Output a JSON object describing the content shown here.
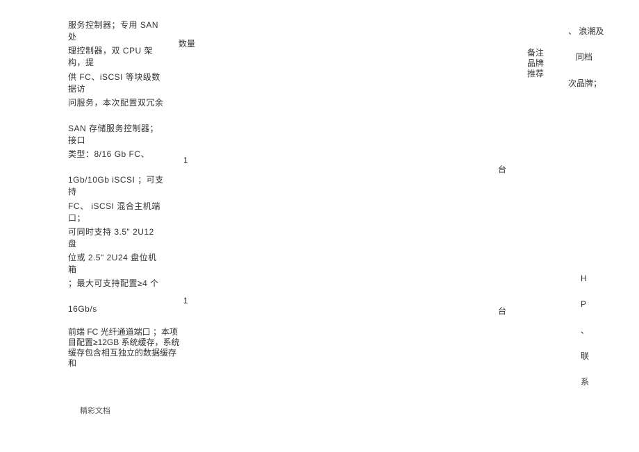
{
  "leftColumn": {
    "line1": "服务控制器；专用   SAN 处",
    "line2": "理控制器，双 CPU 架构，提",
    "line3": "供 FC、iSCSI 等块级数据访",
    "line4": "问服务，本次配置双冗余",
    "line5": "SAN 存储服务控制器；接口",
    "line6": "类型：8/16 Gb FC、",
    "line7": "1Gb/10Gb iSCSI ；可支持",
    "line8": "FC、 iSCSI 混合主机端  口；",
    "line9": "可同时支持 3.5\"   2U12 盘",
    "line10": "位或 2.5\"   2U24 盘位机箱",
    "line11": "；最大可支持配置≥4 个",
    "line12": "16Gb/s",
    "line13a": "前端 FC 光纤通道端口    ；本项",
    "line13b": "目配置≥12GB 系统缓存，系统",
    "line13c": "缓存包含相互独立的数据缓存",
    "line13d": "和"
  },
  "midCol": {
    "qty_header": "数量",
    "qty1": "1",
    "qty2": "1"
  },
  "unitCol": {
    "unit1": "台",
    "unit2": "台"
  },
  "remarksCol": {
    "line1": "备注",
    "line2": "品牌",
    "line3": "推荐"
  },
  "rightCol": {
    "r1": "、 浪潮及",
    "r2": "同档",
    "r3": "次品牌；",
    "v1": "H",
    "v2": "P",
    "v3": "、",
    "v4": "联",
    "v5": "系"
  },
  "footer": "精彩文档"
}
